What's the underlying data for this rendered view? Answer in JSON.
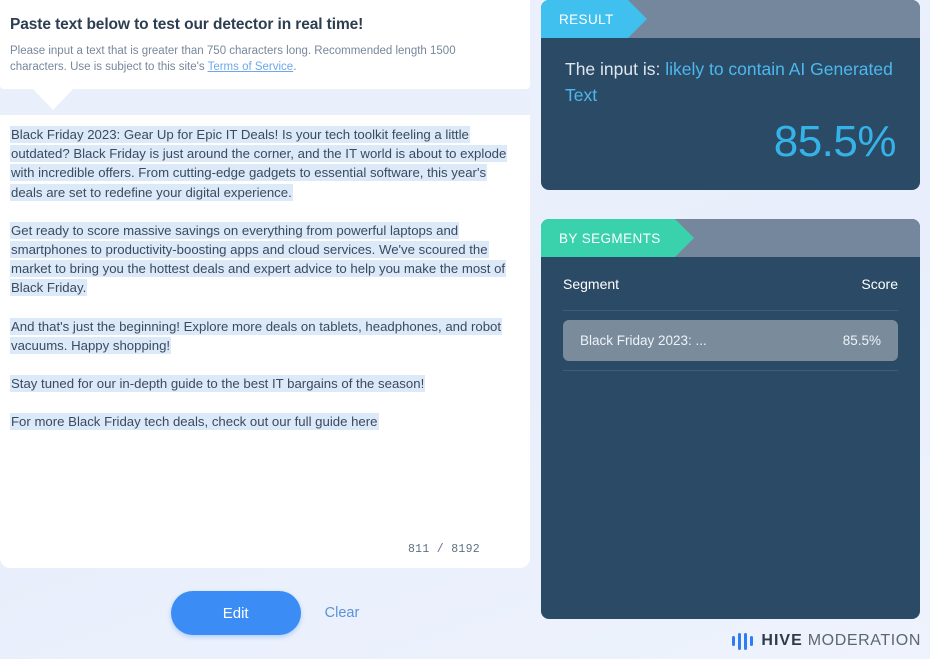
{
  "left": {
    "intro": {
      "title": "Paste text below to test our detector in real time!",
      "subtitle_pre": "Please input a text that is greater than 750 characters long. Recommended length 1500 characters. Use is subject to this site's ",
      "link_label": "Terms of Service",
      "subtitle_post": "."
    },
    "textarea": {
      "paragraphs": [
        "Black Friday 2023: Gear Up for Epic IT Deals!\nIs your tech toolkit feeling a little outdated? Black Friday is just around the corner, and the IT world is about to explode with incredible offers. From cutting-edge gadgets to essential software, this year's deals are set to redefine your digital experience.",
        "Get ready to score massive savings on everything from powerful laptops and smartphones to productivity-boosting apps and cloud services. We've scoured the market to bring you the hottest deals and expert advice to help you make the most of Black Friday.",
        "And that's just the beginning! Explore more deals on tablets, headphones, and robot vacuums. Happy shopping!",
        "Stay tuned for our in-depth guide to the best IT bargains of the season!",
        "For more Black Friday tech deals, check out our full guide here"
      ],
      "char_count": "811 / 8192"
    },
    "actions": {
      "edit_label": "Edit",
      "clear_label": "Clear"
    }
  },
  "right": {
    "result": {
      "ribbon_label": "RESULT",
      "prefix": "The input is:",
      "verdict": "likely to contain AI Generated Text",
      "percent": "85.5%"
    },
    "segments": {
      "ribbon_label": "BY SEGMENTS",
      "col_segment": "Segment",
      "col_score": "Score",
      "rows": [
        {
          "segment": "Black Friday 2023: ...",
          "score": "85.5%"
        }
      ]
    }
  },
  "footer": {
    "logo_primary": "HIVE",
    "logo_secondary": "MODERATION"
  },
  "colors": {
    "accent_blue": "#3b8cf4",
    "ribbon_result": "#3fc0ef",
    "ribbon_segments": "#3ad2ac",
    "panel_bg": "#2a4a66",
    "panel_head": "#74879c",
    "highlight": "#dce9f9",
    "percent": "#35b3e8"
  }
}
